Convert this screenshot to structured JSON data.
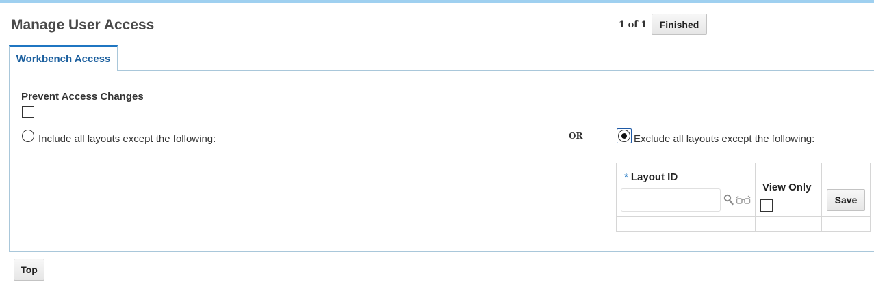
{
  "header": {
    "title": "Manage User Access",
    "pager": "1 of 1",
    "finished_label": "Finished"
  },
  "tabs": [
    {
      "label": "Workbench Access",
      "active": true
    }
  ],
  "prevent_access": {
    "label": "Prevent Access Changes",
    "checked": false
  },
  "options": {
    "include_label": "Include all layouts except the following:",
    "include_selected": false,
    "or_label": "OR",
    "exclude_label": "Exclude all layouts except the following:",
    "exclude_selected": true
  },
  "layout_table": {
    "required_marker": "*",
    "layout_id_header": "Layout ID",
    "layout_id_value": "",
    "view_only_header": "View Only",
    "view_only_checked": false,
    "save_label": "Save",
    "icons": [
      "search-icon",
      "glasses-icon"
    ]
  },
  "footer": {
    "top_label": "Top"
  },
  "colors": {
    "accent": "#1f76c2",
    "tab_text": "#1b5f9e",
    "top_strip": "#9fd0f0"
  }
}
